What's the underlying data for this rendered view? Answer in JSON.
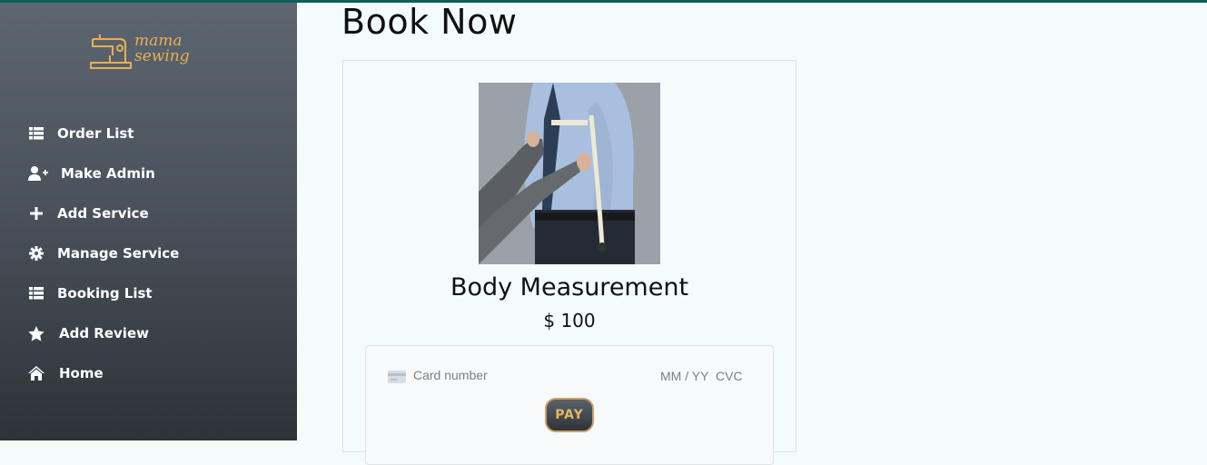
{
  "brand": {
    "line1": "mama",
    "line2": "sewing",
    "color": "#e7b052"
  },
  "sidebar": {
    "items": [
      {
        "label": "Order List",
        "icon": "list-icon"
      },
      {
        "label": "Make Admin",
        "icon": "user-plus-icon"
      },
      {
        "label": "Add Service",
        "icon": "plus-icon"
      },
      {
        "label": "Manage Service",
        "icon": "gear-icon"
      },
      {
        "label": "Booking List",
        "icon": "list-icon"
      },
      {
        "label": "Add Review",
        "icon": "star-icon"
      },
      {
        "label": "Home",
        "icon": "home-icon"
      }
    ]
  },
  "page": {
    "title": "Book Now"
  },
  "service": {
    "name": "Body Measurement",
    "price": "$ 100",
    "image": "tailor-measuring-shirt-photo"
  },
  "payment": {
    "card_placeholder": "Card number",
    "expiry_placeholder": "MM / YY",
    "cvc_placeholder": "CVC",
    "pay_label": "PAY"
  },
  "colors": {
    "accent": "#0f5e5c",
    "sidebar_top": "#5d6670",
    "sidebar_bottom": "#2d3338",
    "pay_text": "#e2b865"
  }
}
